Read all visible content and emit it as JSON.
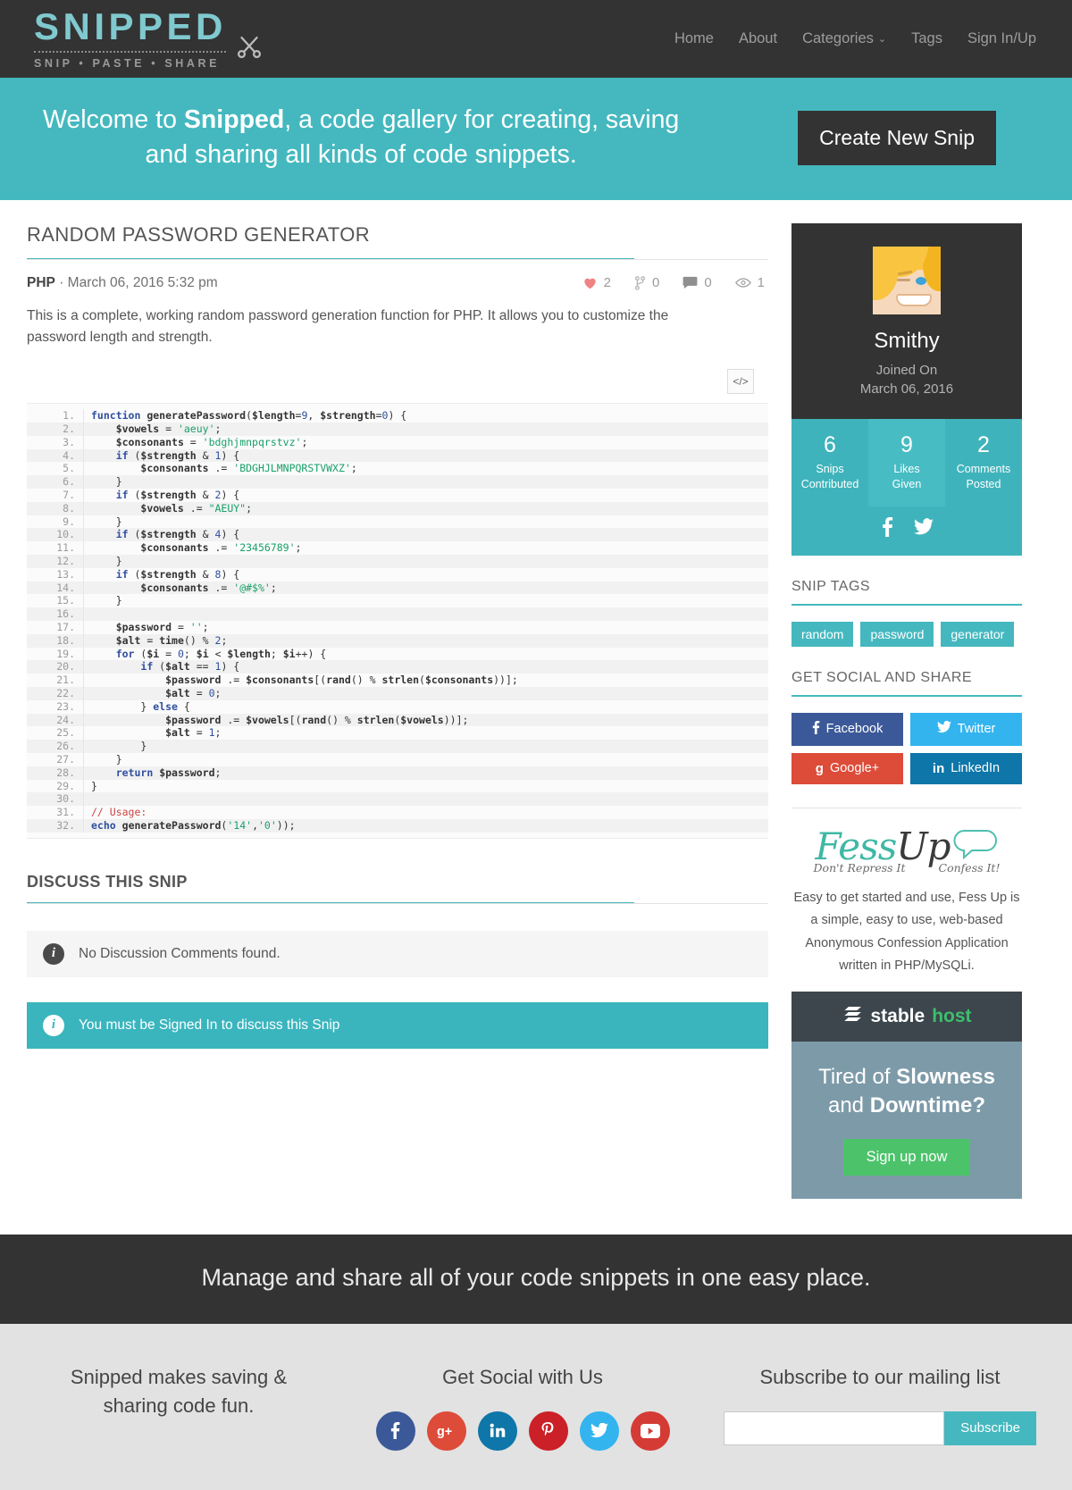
{
  "header": {
    "brand_title": "SNIPPED",
    "brand_sub": "SNIP • PASTE • SHARE",
    "scissors_icon": "scissors-icon",
    "nav": [
      {
        "label": "Home"
      },
      {
        "label": "About"
      },
      {
        "label": "Categories",
        "caret": "⌄"
      },
      {
        "label": "Tags"
      },
      {
        "label": "Sign In/Up"
      }
    ]
  },
  "hero": {
    "line1_pre": "Welcome to ",
    "brand": "Snipped",
    "line1_post": ", a code gallery for creating, saving",
    "line2": "and sharing all kinds of code snippets.",
    "button": "Create New Snip"
  },
  "snip": {
    "title": "RANDOM PASSWORD GENERATOR",
    "language": "PHP",
    "separator": "·",
    "date": "March 06, 2016 5:32 pm",
    "description": "This is a complete, working random password generation function for PHP. It allows you to customize the password length and strength.",
    "stats": [
      {
        "icon": "heart-icon",
        "value": "2"
      },
      {
        "icon": "fork-icon",
        "value": "0"
      },
      {
        "icon": "comment-icon",
        "value": "0"
      },
      {
        "icon": "eye-icon",
        "value": "1"
      }
    ],
    "code_toggle_icon": "code-brackets-icon",
    "code_lines": [
      {
        "n": "1.",
        "html": "<span class=\"k\">function</span> <span class=\"fn\">generatePassword</span>(<span class=\"v\">$length</span>=<span class=\"n\">9</span>, <span class=\"v\">$strength</span>=<span class=\"n\">0</span>) {"
      },
      {
        "n": "2.",
        "html": "    <span class=\"v\">$vowels</span> = <span class=\"s\">'aeuy'</span>;"
      },
      {
        "n": "3.",
        "html": "    <span class=\"v\">$consonants</span> = <span class=\"s\">'bdghjmnpqrstvz'</span>;"
      },
      {
        "n": "4.",
        "html": "    <span class=\"k\">if</span> (<span class=\"v\">$strength</span> &amp; <span class=\"n\">1</span>) {"
      },
      {
        "n": "5.",
        "html": "        <span class=\"v\">$consonants</span> .= <span class=\"s\">'BDGHJLMNPQRSTVWXZ'</span>;"
      },
      {
        "n": "6.",
        "html": "    }"
      },
      {
        "n": "7.",
        "html": "    <span class=\"k\">if</span> (<span class=\"v\">$strength</span> &amp; <span class=\"n\">2</span>) {"
      },
      {
        "n": "8.",
        "html": "        <span class=\"v\">$vowels</span> .= <span class=\"s\">\"AEUY\"</span>;"
      },
      {
        "n": "9.",
        "html": "    }"
      },
      {
        "n": "10.",
        "html": "    <span class=\"k\">if</span> (<span class=\"v\">$strength</span> &amp; <span class=\"n\">4</span>) {"
      },
      {
        "n": "11.",
        "html": "        <span class=\"v\">$consonants</span> .= <span class=\"s\">'23456789'</span>;"
      },
      {
        "n": "12.",
        "html": "    }"
      },
      {
        "n": "13.",
        "html": "    <span class=\"k\">if</span> (<span class=\"v\">$strength</span> &amp; <span class=\"n\">8</span>) {"
      },
      {
        "n": "14.",
        "html": "        <span class=\"v\">$consonants</span> .= <span class=\"s\">'@#$%'</span>;"
      },
      {
        "n": "15.",
        "html": "    }"
      },
      {
        "n": "16.",
        "html": ""
      },
      {
        "n": "17.",
        "html": "    <span class=\"v\">$password</span> = <span class=\"s\">''</span>;"
      },
      {
        "n": "18.",
        "html": "    <span class=\"v\">$alt</span> = <span class=\"fn\">time</span>() % <span class=\"n\">2</span>;"
      },
      {
        "n": "19.",
        "html": "    <span class=\"k\">for</span> (<span class=\"v\">$i</span> = <span class=\"n\">0</span>; <span class=\"v\">$i</span> &lt; <span class=\"v\">$length</span>; <span class=\"v\">$i</span>++) {"
      },
      {
        "n": "20.",
        "html": "        <span class=\"k\">if</span> (<span class=\"v\">$alt</span> == <span class=\"n\">1</span>) {"
      },
      {
        "n": "21.",
        "html": "            <span class=\"v\">$password</span> .= <span class=\"v\">$consonants</span>[(<span class=\"fn\">rand</span>() % <span class=\"fn\">strlen</span>(<span class=\"v\">$consonants</span>))];"
      },
      {
        "n": "22.",
        "html": "            <span class=\"v\">$alt</span> = <span class=\"n\">0</span>;"
      },
      {
        "n": "23.",
        "html": "        } <span class=\"k\">else</span> {"
      },
      {
        "n": "24.",
        "html": "            <span class=\"v\">$password</span> .= <span class=\"v\">$vowels</span>[(<span class=\"fn\">rand</span>() % <span class=\"fn\">strlen</span>(<span class=\"v\">$vowels</span>))];"
      },
      {
        "n": "25.",
        "html": "            <span class=\"v\">$alt</span> = <span class=\"n\">1</span>;"
      },
      {
        "n": "26.",
        "html": "        }"
      },
      {
        "n": "27.",
        "html": "    }"
      },
      {
        "n": "28.",
        "html": "    <span class=\"k\">return</span> <span class=\"v\">$password</span>;"
      },
      {
        "n": "29.",
        "html": "}"
      },
      {
        "n": "30.",
        "html": ""
      },
      {
        "n": "31.",
        "html": "<span class=\"c\">// Usage:</span>"
      },
      {
        "n": "32.",
        "html": "<span class=\"k\">echo</span> <span class=\"fn\">generatePassword</span>(<span class=\"s\">'14'</span>,<span class=\"s\">'0'</span>));"
      }
    ]
  },
  "discuss": {
    "heading": "DISCUSS THIS SNIP",
    "no_comments": "No Discussion Comments found.",
    "signin_notice": "You must be Signed In to discuss this Snip",
    "info_icon": "info-icon"
  },
  "sidebar": {
    "profile": {
      "avatar_icon": "user-avatar",
      "name": "Smithy",
      "joined_label": "Joined On",
      "joined_date": "March 06, 2016",
      "stats": [
        {
          "num": "6",
          "label": "Snips\nContributed"
        },
        {
          "num": "9",
          "label": "Likes\nGiven"
        },
        {
          "num": "2",
          "label": "Comments\nPosted"
        }
      ],
      "social": [
        {
          "icon": "facebook-icon"
        },
        {
          "icon": "twitter-icon"
        }
      ]
    },
    "tags_heading": "SNIP TAGS",
    "tags": [
      "random",
      "password",
      "generator"
    ],
    "share_heading": "GET SOCIAL AND SHARE",
    "share_buttons": [
      {
        "label": "Facebook",
        "glyph": "f",
        "icon": "facebook-icon",
        "cls": "sb-fb"
      },
      {
        "label": "Twitter",
        "glyph": "🐦",
        "icon": "twitter-icon",
        "cls": "sb-tw"
      },
      {
        "label": "Google+",
        "glyph": "g",
        "icon": "googleplus-icon",
        "cls": "sb-gp"
      },
      {
        "label": "LinkedIn",
        "glyph": "in",
        "icon": "linkedin-icon",
        "cls": "sb-li"
      }
    ],
    "fessup": {
      "logo_fess": "Fess",
      "logo_up": "Up",
      "tag_left": "Don't Repress It",
      "tag_right": "Confess It!",
      "description": "Easy to get started and use, Fess Up is a simple, easy to use, web-based Anonymous Confession Application written in PHP/MySQLi."
    },
    "ad": {
      "brand_first": "stable",
      "brand_second": "host",
      "logo_icon": "stablehost-logo-icon",
      "line1_pre": "Tired of ",
      "line1_bold": "Slowness",
      "line2_pre": "and ",
      "line2_bold": "Downtime?",
      "cta": "Sign up now"
    }
  },
  "footer": {
    "band_text": "Manage and share all of your code snippets in one easy place.",
    "col1_title": "Snipped makes saving & sharing code fun.",
    "col2_title": "Get Social with Us",
    "social": [
      {
        "icon": "facebook-icon",
        "cls": "c-fb"
      },
      {
        "icon": "googleplus-icon",
        "cls": "c-gp"
      },
      {
        "icon": "linkedin-icon",
        "cls": "c-li"
      },
      {
        "icon": "pinterest-icon",
        "cls": "c-pi"
      },
      {
        "icon": "twitter-icon",
        "cls": "c-tw"
      },
      {
        "icon": "youtube-icon",
        "cls": "c-yt"
      }
    ],
    "col3_title": "Subscribe to our mailing list",
    "subscribe_value": "",
    "subscribe_placeholder": "",
    "subscribe_button": "Subscribe"
  },
  "colors": {
    "accent": "#45b8bf",
    "dark": "#333333",
    "heart": "#ef8383"
  }
}
